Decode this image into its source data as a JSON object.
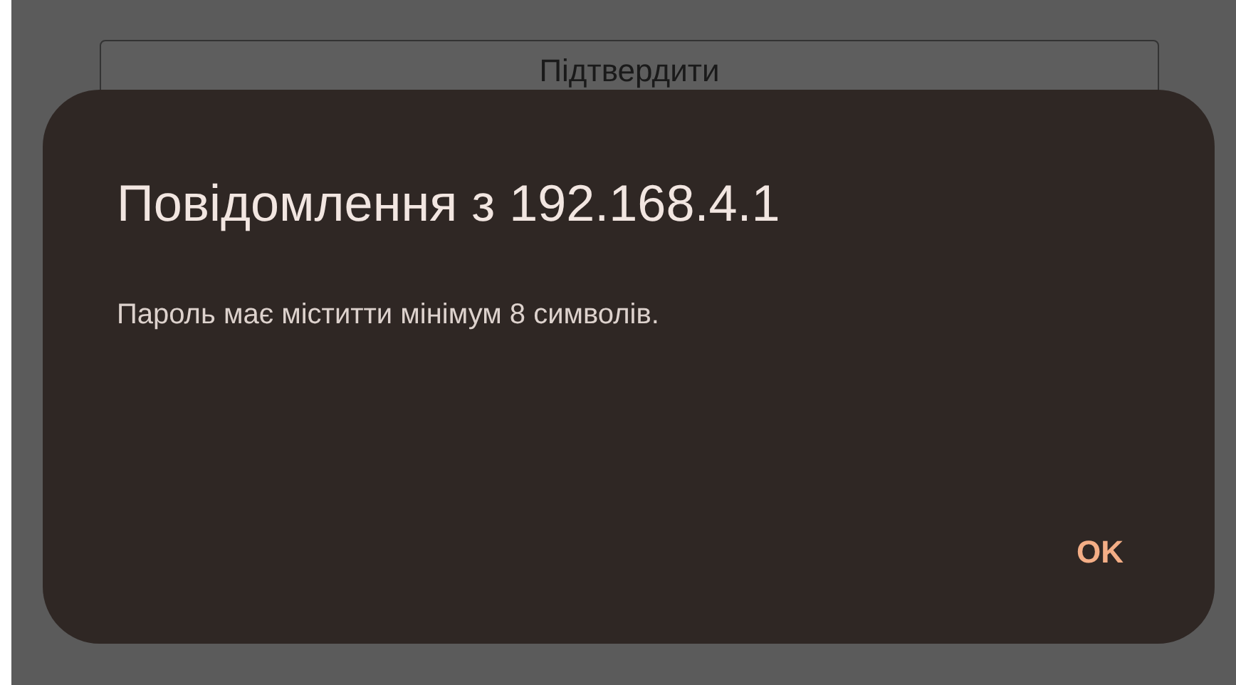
{
  "background_button": {
    "label": "Підтвердити"
  },
  "dialog": {
    "title": "Повідомлення з 192.168.4.1",
    "message": "Пароль має міститти мінімум 8 символів.",
    "buttons": [
      "OK"
    ]
  }
}
